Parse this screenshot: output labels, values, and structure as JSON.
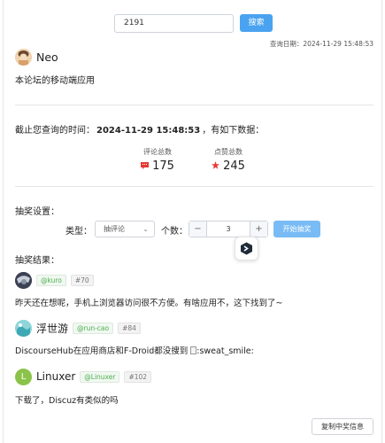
{
  "search": {
    "value": "2191",
    "button_label": "搜索"
  },
  "query_date": "查询日期：2024-11-29 15:48:53",
  "topic": {
    "author_name": "Neo",
    "title": "本论坛的移动端应用"
  },
  "summary": {
    "prefix": "截止您查询的时间：",
    "time": "2024-11-29 15:48:53",
    "suffix": "，有如下数据："
  },
  "stats": {
    "comments_label": "评论总数",
    "comments_value": "175",
    "likes_label": "点赞总数",
    "likes_value": "245"
  },
  "lottery": {
    "settings_label": "抽奖设置：",
    "type_label": "类型：",
    "type_selected": "抽评论",
    "count_label": "个数：",
    "count_value": "3",
    "minus": "−",
    "plus": "+",
    "start_button": "开始抽奖",
    "results_label": "抽奖结果："
  },
  "results": [
    {
      "display_name": "",
      "handle": "@kuro",
      "floor": "#70",
      "content": "昨天还在想呢，手机上浏览器访问很不方便。有啥应用不，这下找到了~"
    },
    {
      "display_name": "浮世游",
      "handle": "@run-cao",
      "floor": "#84",
      "content": "DiscourseHub在应用商店和F-Droid都没搜到 ",
      "broken_image_alt": ":sweat_smile:"
    },
    {
      "display_name": "Linuxer",
      "handle": "@Linuxer",
      "floor": "#102",
      "avatar_letter": "L",
      "content": "下载了，Discuz有类似的吗"
    }
  ],
  "copy_button": "复制中奖信息",
  "colors": {
    "primary": "#4aa3f0",
    "primary_light": "#79bbf5",
    "comment_icon": "#e53935",
    "like_icon": "#e53935",
    "handle_green": "#4caf50",
    "linuxer_avatar": "#8bc34a"
  }
}
